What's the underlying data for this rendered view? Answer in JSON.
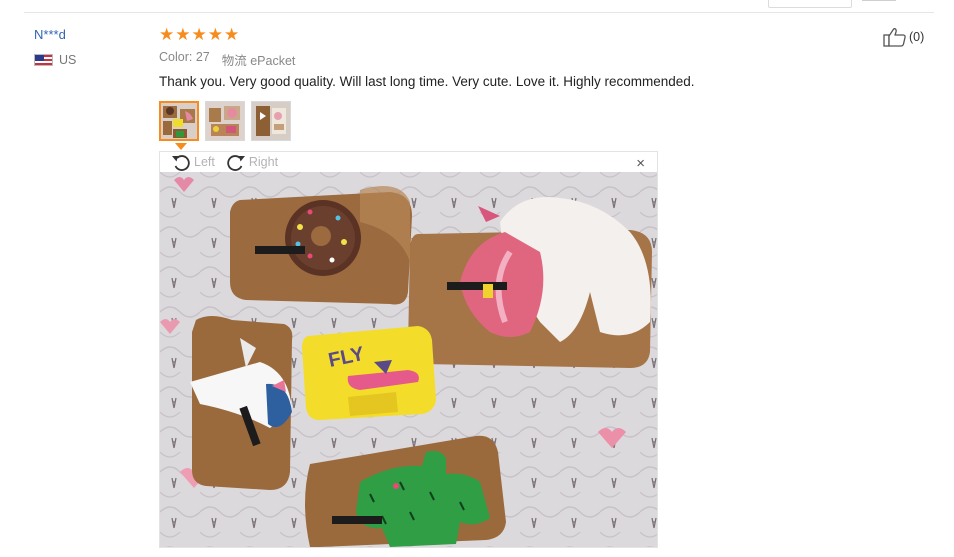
{
  "review": {
    "user_name": "N***d",
    "country": "US",
    "rating_stars": 5,
    "star_glyph": "★",
    "color_option": "Color: 27",
    "shipping": "物流 ePacket",
    "text": "Thank you. Very good quality. Will last long time. Very cute. Love it. Highly recommended.",
    "helpful_count": "(0)",
    "thumbnails": 3
  },
  "viewer": {
    "rotate_left_label": "Left",
    "rotate_right_label": "Right",
    "close_label": "×"
  },
  "colors": {
    "link": "#3066b1",
    "star": "#f68b1e",
    "muted": "#888888"
  },
  "icons": {
    "helpful": "thumbs-up-icon",
    "rotate_left": "rotate-left-icon",
    "rotate_right": "rotate-right-icon",
    "close": "close-icon",
    "flag": "us-flag-icon"
  }
}
